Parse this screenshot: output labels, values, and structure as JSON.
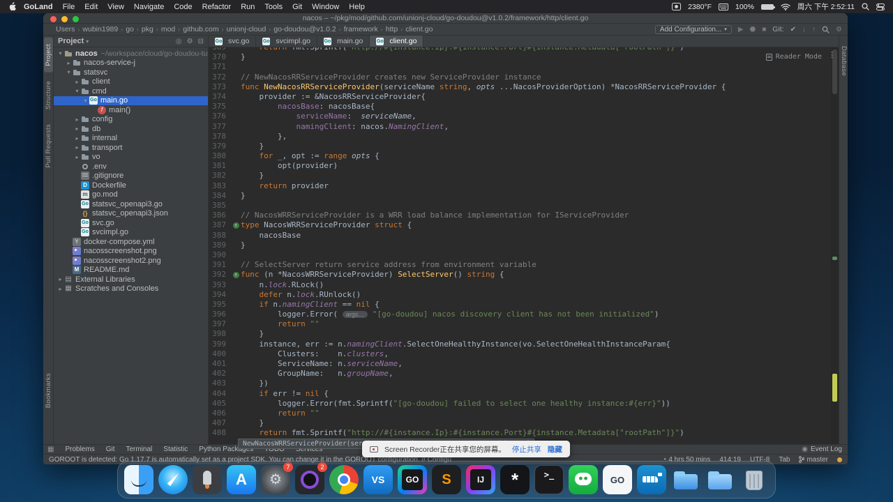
{
  "theme": {
    "editor_bg": "#2b2b2b",
    "chrome_bg": "#3c3f41",
    "selection_blue": "#2f65ca",
    "keyword_orange": "#cc7832",
    "string_green": "#6a8759",
    "comment_gray": "#808080",
    "func_yellow": "#ffc66b",
    "field_purple": "#9876aa",
    "badge_red": "#ec4b3c"
  },
  "menu_bar": {
    "items": [
      "GoLand",
      "File",
      "Edit",
      "View",
      "Navigate",
      "Code",
      "Refactor",
      "Run",
      "Tools",
      "Git",
      "Window",
      "Help"
    ],
    "status": {
      "temp": "2380°F",
      "battery": "100%",
      "clock": "周六 下午 2:52:11"
    }
  },
  "titlebar": {
    "title": "nacos – ~/pkg/mod/github.com/unionj-cloud/go-doudou@v1.0.2/framework/http/client.go"
  },
  "breadcrumbs": [
    "Users",
    "wubin1989",
    "go",
    "pkg",
    "mod",
    "github.com",
    "unionj-cloud",
    "go-doudou@v1.0.2",
    "framework",
    "http",
    "client.go"
  ],
  "toolbar": {
    "add_configuration": "Add Configuration...",
    "git_label": "Git:"
  },
  "stripes": {
    "left": [
      "Project",
      "Structure",
      "Pull Requests"
    ],
    "left_bottom": [
      "Bookmarks"
    ],
    "right": [
      "Database"
    ]
  },
  "project": {
    "header": "Project",
    "tree": [
      {
        "d": 0,
        "chev": "open",
        "icon": "project",
        "label": "nacos",
        "b": true,
        "extra": "~/workspace/cloud/go-doudou-tutorial"
      },
      {
        "d": 1,
        "chev": "closed",
        "icon": "folder",
        "label": "nacos-service-j"
      },
      {
        "d": 1,
        "chev": "open",
        "icon": "folder",
        "label": "statsvc"
      },
      {
        "d": 2,
        "chev": "closed",
        "icon": "folder",
        "label": "client"
      },
      {
        "d": 2,
        "chev": "open",
        "icon": "folder",
        "label": "cmd"
      },
      {
        "d": 3,
        "chev": "open",
        "icon": "go",
        "label": "main.go",
        "sel": true
      },
      {
        "d": 4,
        "icon": "func",
        "label": "main()"
      },
      {
        "d": 2,
        "chev": "closed",
        "icon": "folder",
        "label": "config"
      },
      {
        "d": 2,
        "chev": "closed",
        "icon": "folder",
        "label": "db"
      },
      {
        "d": 2,
        "chev": "closed",
        "icon": "folder",
        "label": "internal"
      },
      {
        "d": 2,
        "chev": "closed",
        "icon": "folder",
        "label": "transport"
      },
      {
        "d": 2,
        "chev": "closed",
        "icon": "folder",
        "label": "vo"
      },
      {
        "d": 2,
        "icon": "env",
        "label": ".env"
      },
      {
        "d": 2,
        "icon": "ignore",
        "label": ".gitignore"
      },
      {
        "d": 2,
        "icon": "docker",
        "label": "Dockerfile"
      },
      {
        "d": 2,
        "icon": "gomod",
        "label": "go.mod"
      },
      {
        "d": 2,
        "icon": "go",
        "label": "statsvc_openapi3.go"
      },
      {
        "d": 2,
        "icon": "json",
        "label": "statsvc_openapi3.json"
      },
      {
        "d": 2,
        "icon": "go",
        "label": "svc.go"
      },
      {
        "d": 2,
        "icon": "go",
        "label": "svcimpl.go"
      },
      {
        "d": 1,
        "icon": "yaml",
        "label": "docker-compose.yml"
      },
      {
        "d": 1,
        "icon": "img",
        "label": "nacosscreenshot.png"
      },
      {
        "d": 1,
        "icon": "img",
        "label": "nacosscreenshot2.png"
      },
      {
        "d": 1,
        "icon": "md",
        "label": "README.md"
      },
      {
        "d": 0,
        "chev": "closed",
        "icon": "lib",
        "label": "External Libraries"
      },
      {
        "d": 0,
        "chev": "closed",
        "icon": "scratch",
        "label": "Scratches and Consoles"
      }
    ]
  },
  "tabs": [
    {
      "label": "svc.go"
    },
    {
      "label": "svcimpl.go"
    },
    {
      "label": "main.go"
    },
    {
      "label": "client.go",
      "active": true
    }
  ],
  "editor": {
    "reader_mode": "Reader Mode",
    "lines": [
      {
        "n": 369,
        "clip": true,
        "s": [
          [
            "t",
            "    "
          ],
          [
            "k",
            "return"
          ],
          [
            "t",
            " fmt.Sprintf("
          ],
          [
            "s",
            "\"http://#{instance.Ip}:#{instance.Port}#{instance.Metadata[\"rootPath\"]}\""
          ],
          [
            "t",
            ")"
          ]
        ]
      },
      {
        "n": 370,
        "s": [
          [
            "t",
            "}"
          ]
        ]
      },
      {
        "n": 371,
        "s": []
      },
      {
        "n": 372,
        "s": [
          [
            "c",
            "// NewNacosRRServiceProvider creates new ServiceProvider instance"
          ]
        ]
      },
      {
        "n": 373,
        "s": [
          [
            "k",
            "func"
          ],
          [
            "t",
            " "
          ],
          [
            "f",
            "NewNacosRRServiceProvider"
          ],
          [
            "t",
            "(serviceName "
          ],
          [
            "k",
            "string"
          ],
          [
            "t",
            ", "
          ],
          [
            "ti",
            "opts"
          ],
          [
            "t",
            " ...NacosProviderOption) *NacosRRServiceProvider {"
          ]
        ]
      },
      {
        "n": 374,
        "s": [
          [
            "t",
            "    provider := &NacosRRServiceProvider{"
          ]
        ]
      },
      {
        "n": 375,
        "s": [
          [
            "t",
            "        "
          ],
          [
            "p",
            "nacosBase"
          ],
          [
            "t",
            ": nacosBase{"
          ]
        ]
      },
      {
        "n": 376,
        "s": [
          [
            "t",
            "            "
          ],
          [
            "p",
            "serviceName"
          ],
          [
            "t",
            ":  "
          ],
          [
            "ti",
            "serviceName"
          ],
          [
            "t",
            ","
          ]
        ]
      },
      {
        "n": 377,
        "s": [
          [
            "t",
            "            "
          ],
          [
            "p",
            "namingClient"
          ],
          [
            "t",
            ": nacos."
          ],
          [
            "pi",
            "NamingClient"
          ],
          [
            "t",
            ","
          ]
        ]
      },
      {
        "n": 378,
        "s": [
          [
            "t",
            "        },"
          ]
        ]
      },
      {
        "n": 379,
        "s": [
          [
            "t",
            "    }"
          ]
        ]
      },
      {
        "n": 380,
        "s": [
          [
            "t",
            "    "
          ],
          [
            "k",
            "for"
          ],
          [
            "t",
            " _, opt := "
          ],
          [
            "k",
            "range"
          ],
          [
            "t",
            " "
          ],
          [
            "ti",
            "opts"
          ],
          [
            "t",
            " {"
          ]
        ]
      },
      {
        "n": 381,
        "s": [
          [
            "t",
            "        opt(provider)"
          ]
        ]
      },
      {
        "n": 382,
        "s": [
          [
            "t",
            "    }"
          ]
        ]
      },
      {
        "n": 383,
        "s": [
          [
            "t",
            "    "
          ],
          [
            "k",
            "return"
          ],
          [
            "t",
            " provider"
          ]
        ]
      },
      {
        "n": 384,
        "s": [
          [
            "t",
            "}"
          ]
        ]
      },
      {
        "n": 385,
        "s": []
      },
      {
        "n": 386,
        "s": [
          [
            "c",
            "// NacosWRRServiceProvider is a WRR load balance implementation for IServiceProvider"
          ]
        ]
      },
      {
        "n": 387,
        "m": "impl",
        "s": [
          [
            "k",
            "type"
          ],
          [
            "t",
            " NacosWRRServiceProvider "
          ],
          [
            "k",
            "struct"
          ],
          [
            "t",
            " {"
          ]
        ]
      },
      {
        "n": 388,
        "s": [
          [
            "t",
            "    nacosBase"
          ]
        ]
      },
      {
        "n": 389,
        "s": [
          [
            "t",
            "}"
          ]
        ]
      },
      {
        "n": 390,
        "s": []
      },
      {
        "n": 391,
        "s": [
          [
            "c",
            "// SelectServer return service address from environment variable"
          ]
        ]
      },
      {
        "n": 392,
        "m": "impl",
        "s": [
          [
            "k",
            "func"
          ],
          [
            "t",
            " (n *NacosWRRServiceProvider) "
          ],
          [
            "f",
            "SelectServer"
          ],
          [
            "t",
            "() "
          ],
          [
            "k",
            "string"
          ],
          [
            "t",
            " {"
          ]
        ]
      },
      {
        "n": 393,
        "s": [
          [
            "t",
            "    n."
          ],
          [
            "pi",
            "lock"
          ],
          [
            "t",
            ".RLock()"
          ]
        ]
      },
      {
        "n": 394,
        "s": [
          [
            "t",
            "    "
          ],
          [
            "k",
            "defer"
          ],
          [
            "t",
            " n."
          ],
          [
            "pi",
            "lock"
          ],
          [
            "t",
            ".RUnlock()"
          ]
        ]
      },
      {
        "n": 395,
        "s": [
          [
            "t",
            "    "
          ],
          [
            "k",
            "if"
          ],
          [
            "t",
            " n."
          ],
          [
            "pi",
            "namingClient"
          ],
          [
            "t",
            " == "
          ],
          [
            "k",
            "nil"
          ],
          [
            "t",
            " {"
          ]
        ]
      },
      {
        "n": 396,
        "s": [
          [
            "t",
            "        logger.Error( "
          ],
          [
            "h",
            "args…"
          ],
          [
            "t",
            " "
          ],
          [
            "s",
            "\"[go-doudou] nacos discovery client has not been initialized\""
          ],
          [
            "t",
            ")"
          ]
        ]
      },
      {
        "n": 397,
        "s": [
          [
            "t",
            "        "
          ],
          [
            "k",
            "return"
          ],
          [
            "t",
            " "
          ],
          [
            "s",
            "\"\""
          ]
        ]
      },
      {
        "n": 398,
        "s": [
          [
            "t",
            "    }"
          ]
        ]
      },
      {
        "n": 399,
        "s": [
          [
            "t",
            "    instance, err := n."
          ],
          [
            "pi",
            "namingClient"
          ],
          [
            "t",
            ".SelectOneHealthyInstance(vo.SelectOneHealthInstanceParam{"
          ]
        ]
      },
      {
        "n": 400,
        "s": [
          [
            "t",
            "        Clusters:    n."
          ],
          [
            "pi",
            "clusters"
          ],
          [
            "t",
            ","
          ]
        ]
      },
      {
        "n": 401,
        "s": [
          [
            "t",
            "        ServiceName: n."
          ],
          [
            "pi",
            "serviceName"
          ],
          [
            "t",
            ","
          ]
        ]
      },
      {
        "n": 402,
        "s": [
          [
            "t",
            "        GroupName:   n."
          ],
          [
            "pi",
            "groupName"
          ],
          [
            "t",
            ","
          ]
        ]
      },
      {
        "n": 403,
        "s": [
          [
            "t",
            "    })"
          ]
        ]
      },
      {
        "n": 404,
        "s": [
          [
            "t",
            "    "
          ],
          [
            "k",
            "if"
          ],
          [
            "t",
            " err != "
          ],
          [
            "k",
            "nil"
          ],
          [
            "t",
            " {"
          ]
        ]
      },
      {
        "n": 405,
        "s": [
          [
            "t",
            "        logger.Error(fmt.Sprintf("
          ],
          [
            "s",
            "\"[go-doudou] failed to select one healthy instance:#{err}\""
          ],
          [
            "t",
            "))"
          ]
        ]
      },
      {
        "n": 406,
        "s": [
          [
            "t",
            "        "
          ],
          [
            "k",
            "return"
          ],
          [
            "t",
            " "
          ],
          [
            "s",
            "\"\""
          ]
        ]
      },
      {
        "n": 407,
        "s": [
          [
            "t",
            "    }"
          ]
        ]
      },
      {
        "n": 408,
        "s": [
          [
            "t",
            "    "
          ],
          [
            "k",
            "return"
          ],
          [
            "t",
            " fmt.Sprintf("
          ],
          [
            "s",
            "\"http://#{instance.Ip}:#{instance.Port}#{instance.Metadata[\"rootPath\"]}\""
          ],
          [
            "t",
            ")"
          ]
        ]
      }
    ]
  },
  "popup": {
    "text": "NewNacosWRRServiceProvider(serviceName string, opts ...NacosProviderOption) *NacosWRRServiceProvider"
  },
  "notification": {
    "message": "Screen Recorder正在共享您的屏幕。",
    "stop": "停止共享",
    "hide": "隐藏"
  },
  "bottom_bar": {
    "left": [
      "Problems",
      "Git",
      "Terminal",
      "Statistic",
      "Python Packages",
      "TODO",
      "Services"
    ],
    "event_log": "Event Log"
  },
  "status_bar": {
    "message": "GOROOT is detected: Go 1.17.7 is automatically set as a project SDK. You can change it in the GOROOT configuration. // Configu",
    "uptime": "4 hrs 50 mins",
    "caret": "414:19",
    "encoding": "UTF-8",
    "indent": "Tab",
    "branch": "master"
  },
  "dock": {
    "items": [
      {
        "id": "finder"
      },
      {
        "id": "safari"
      },
      {
        "id": "launchpad"
      },
      {
        "id": "appstore"
      },
      {
        "id": "settings",
        "badge": "7"
      },
      {
        "id": "recorder",
        "badge": "2"
      },
      {
        "id": "chrome"
      },
      {
        "id": "vscode",
        "glyph": "VS"
      },
      {
        "id": "goland",
        "glyph": "GO"
      },
      {
        "id": "sublime",
        "glyph": "S"
      },
      {
        "id": "idea",
        "glyph": "IJ"
      },
      {
        "id": "utility",
        "glyph": "*"
      },
      {
        "id": "terminal",
        "glyph": ">_"
      },
      {
        "id": "wechat"
      },
      {
        "id": "goapp",
        "glyph": "GO"
      },
      {
        "id": "docker"
      },
      {
        "id": "folder1"
      },
      {
        "id": "folder2"
      },
      {
        "id": "trash"
      }
    ]
  }
}
